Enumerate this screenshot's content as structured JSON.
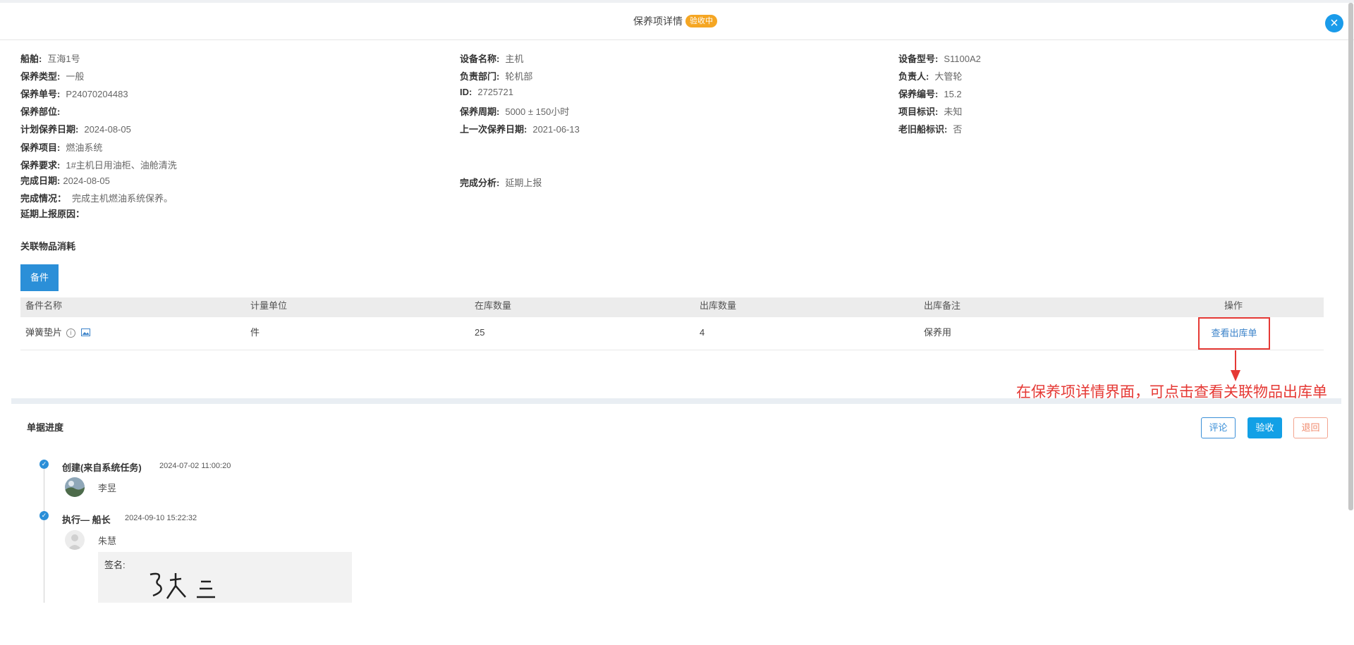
{
  "header": {
    "title": "保养项详情",
    "status_badge": "验收中",
    "close_icon": "close-icon"
  },
  "details": {
    "col1": [
      {
        "label": "船舶:",
        "value": "互海1号"
      },
      {
        "label": "保养类型:",
        "value": "一般"
      },
      {
        "label": "保养单号:",
        "value": "P24070204483"
      },
      {
        "label": "保养部位:",
        "value": ""
      },
      {
        "label": "计划保养日期:",
        "value": "2024-08-05"
      },
      {
        "label": "保养项目:",
        "value": "燃油系统"
      },
      {
        "label": "保养要求:",
        "value": "1#主机日用油柜、油舱清洗"
      },
      {
        "label": "完成日期:",
        "value": "2024-08-05"
      },
      {
        "label": "完成情况：",
        "value": "完成主机燃油系统保养。"
      },
      {
        "label": "延期上报原因：",
        "value": ""
      }
    ],
    "col2": [
      {
        "label": "设备名称:",
        "value": "主机"
      },
      {
        "label": "负责部门:",
        "value": "轮机部"
      },
      {
        "label": "ID:",
        "value": "2725721"
      },
      {
        "label": "保养周期:",
        "value": "5000 ± 150小时"
      },
      {
        "label": "上一次保养日期:",
        "value": "2021-06-13"
      },
      {
        "label": "完成分析:",
        "value": "延期上报"
      }
    ],
    "col3": [
      {
        "label": "设备型号:",
        "value": "S1100A2"
      },
      {
        "label": "负责人:",
        "value": "大管轮"
      },
      {
        "label": "保养编号:",
        "value": "15.2"
      },
      {
        "label": "项目标识:",
        "value": "未知"
      },
      {
        "label": "老旧船标识:",
        "value": "否"
      }
    ]
  },
  "related": {
    "section_title": "关联物品消耗",
    "tab_label": "备件",
    "columns": [
      "备件名称",
      "计量单位",
      "在库数量",
      "出库数量",
      "出库备注",
      "操作"
    ],
    "rows": [
      {
        "name": "弹簧垫片",
        "unit": "件",
        "stock": "25",
        "out": "4",
        "note": "保养用",
        "action": "查看出库单"
      }
    ]
  },
  "annotation": "在保养项详情界面，可点击查看关联物品出库单",
  "progress": {
    "section_title": "单据进度",
    "buttons": {
      "comment": "评论",
      "accept": "验收",
      "return": "退回"
    },
    "steps": [
      {
        "title": "创建(来自系统任务)",
        "time": "2024-07-02 11:00:20",
        "person": "李昱"
      },
      {
        "title": "执行— 船长",
        "time": "2024-09-10 15:22:32",
        "person": "朱慧"
      }
    ],
    "signature_label": "签名:"
  },
  "colors": {
    "primary": "#2b8fd8",
    "badge": "#f5a623",
    "annotation": "#e53935"
  }
}
